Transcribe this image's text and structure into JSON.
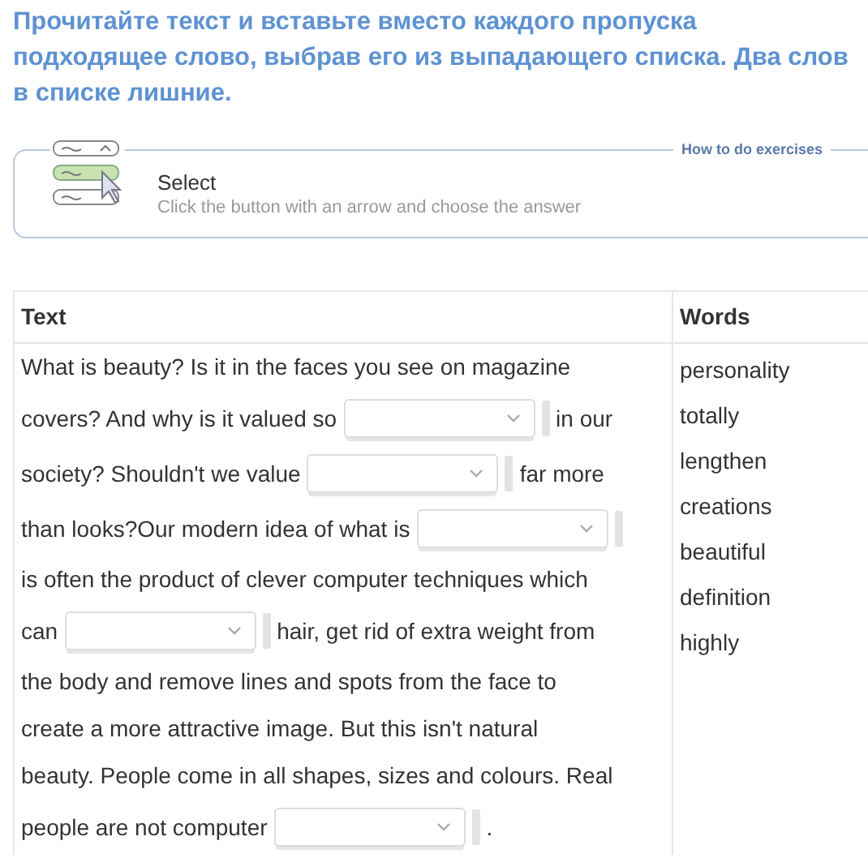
{
  "instruction_lines": [
    "Прочитайте текст и вставьте вместо каждого пропуска",
    "подходящее слово, выбрав его из выпадающего списка. Два слов",
    "в списке лишние."
  ],
  "hint_card": {
    "legend": "How to do exercises",
    "title": "Select",
    "subtitle": "Click the button with an arrow and choose the answer"
  },
  "table": {
    "columns": [
      "Text",
      "Words"
    ],
    "passage_lines": [
      [
        {
          "kind": "text",
          "text": "What is beauty? Is it in the faces you see on magazine"
        }
      ],
      [
        {
          "kind": "text",
          "text": "covers? And why is it valued so"
        },
        {
          "kind": "select"
        },
        {
          "kind": "text",
          "text": "in our"
        }
      ],
      [
        {
          "kind": "text",
          "text": "society? Shouldn't we value"
        },
        {
          "kind": "select"
        },
        {
          "kind": "text",
          "text": "far more"
        }
      ],
      [
        {
          "kind": "text",
          "text": "than looks?Our modern idea of what is"
        },
        {
          "kind": "select"
        }
      ],
      [
        {
          "kind": "text",
          "text": "is often the product of clever computer techniques which"
        }
      ],
      [
        {
          "kind": "text",
          "text": "can"
        },
        {
          "kind": "select"
        },
        {
          "kind": "text",
          "text": "hair, get rid of extra weight from"
        }
      ],
      [
        {
          "kind": "text",
          "text": "the body and remove lines and spots from the face to"
        }
      ],
      [
        {
          "kind": "text",
          "text": "create a more attractive image. But this isn't natural"
        }
      ],
      [
        {
          "kind": "text",
          "text": "beauty. People come in all shapes, sizes and colours. Real"
        }
      ],
      [
        {
          "kind": "text",
          "text": "people are not computer"
        },
        {
          "kind": "select"
        },
        {
          "kind": "text",
          "text": "."
        }
      ]
    ],
    "words": [
      "personality",
      "totally",
      "lengthen",
      "creations",
      "beautiful",
      "definition",
      "highly"
    ]
  }
}
